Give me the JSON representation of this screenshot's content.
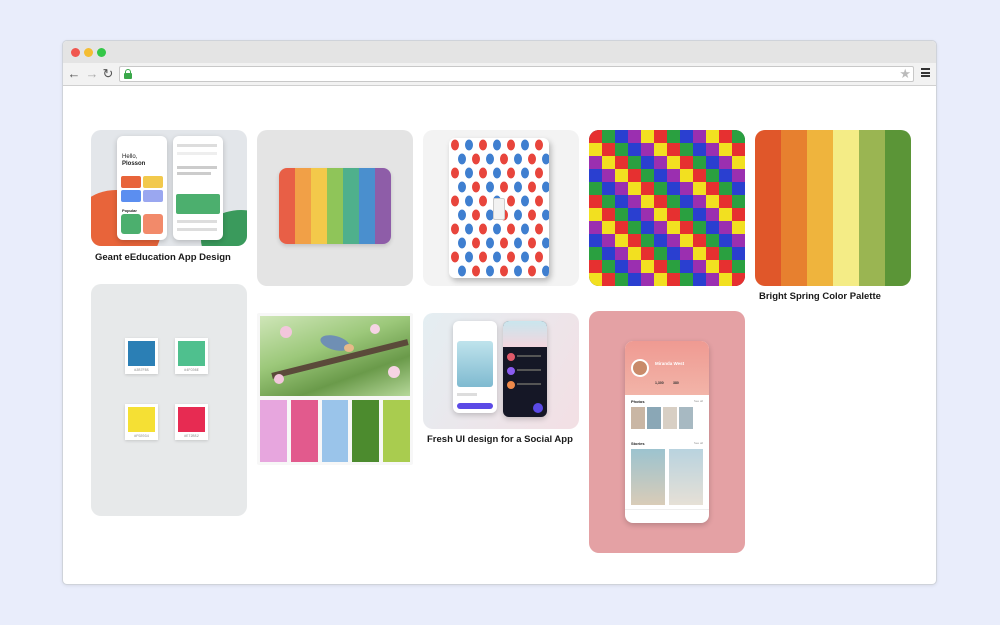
{
  "browser": {
    "back_glyph": "←",
    "forward_glyph": "→",
    "reload_glyph": "↻",
    "star_glyph": "★",
    "address_value": "",
    "icons": [
      "back-arrow-icon",
      "forward-arrow-icon",
      "reload-icon",
      "lock-icon",
      "bookmark-star-icon",
      "hamburger-menu-icon"
    ]
  },
  "tiles": {
    "education": {
      "caption": "Geant eEducation App Design",
      "hello": "Hello,",
      "name": "Plosson",
      "section": "Popular"
    },
    "bright_spring": {
      "caption": "Bright Spring Color Palette",
      "colors": [
        "#e0572a",
        "#e7802f",
        "#efb43d",
        "#f4ec86",
        "#9ab552",
        "#5b9537"
      ]
    },
    "pastel_stripes": {
      "colors": [
        "#e85f46",
        "#f1a047",
        "#f3c94a",
        "#8fc559",
        "#4fb08c",
        "#4a8fce",
        "#8e5da8"
      ]
    },
    "polka": {
      "colors": [
        "#e8453c",
        "#f4c430",
        "#3aa04a",
        "#3f7fd0",
        "#8e5bc0",
        "#ef7f2f"
      ]
    },
    "checker": {
      "colors": [
        "#e63030",
        "#2a3fd0",
        "#f2e020",
        "#2aa040",
        "#9b2fb0"
      ]
    },
    "swatches": {
      "items": [
        {
          "color": "#2b7fb5",
          "code": "#2B7FB5"
        },
        {
          "color": "#4fc08e",
          "code": "#4FC08E"
        },
        {
          "color": "#f5e034",
          "code": "#F5E034"
        },
        {
          "color": "#e72b52",
          "code": "#E72B52"
        }
      ]
    },
    "bird": {
      "colors": [
        "#e7a6de",
        "#e25a8d",
        "#9ac4ea",
        "#4c8b2e",
        "#a9cc4f"
      ]
    },
    "social": {
      "caption": "Fresh UI design for a Social App"
    },
    "profile": {
      "name": "Miranda West",
      "followers": "1,300",
      "following": "380",
      "photos_label": "Photos",
      "stories_label": "Stories",
      "see_all": "See all"
    }
  }
}
